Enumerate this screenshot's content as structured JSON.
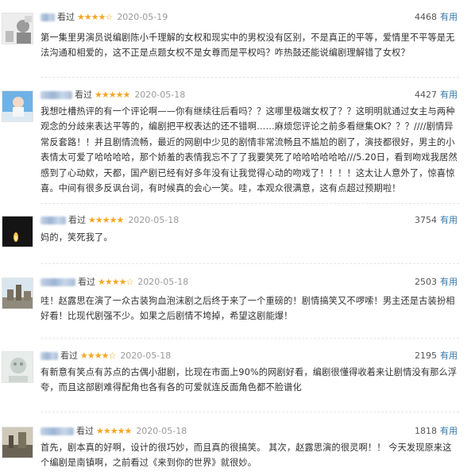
{
  "reviews": [
    {
      "status": "看过",
      "stars": "★★★★☆",
      "date": "2020-05-19",
      "votes": "4468",
      "useful_label": "有用",
      "text": "第一集里男演员说编剧陈小千理解的女权和现实中的男权没有区别，不是真正的平等，爱情里不平等是无法沟通和相爱的，这不正是点题女权不是女尊而是平权吗？咋热鼓还能说编剧理解错了女权？"
    },
    {
      "status": "看过",
      "stars": "★★★★★",
      "date": "2020-05-18",
      "votes": "4427",
      "useful_label": "有用",
      "text": "我想吐槽热评的有一个评论啊——你有继续往后看吗？？这哪里极端女权了？？这明明就通过女主与两种观念的分歧来表达平等的，编剧把平权表达的还不错啊……麻烦您评论之前多看继集OK？？？////剧情异常反套路！！并且剧情流畅，最近的网剧中少见的剧情非常流畅且不尴尬的剧了，演技都很好，男主的小表情太可爱了哈哈哈哈，那个娇羞的表情我忘不了了我要笑死了哈哈哈哈哈哈///5.20日，看到吻戏我居然感到了心动欸，天都，国产剧已经有好多年没有让我觉得心动的吻戏了！！！！这太让人意外了，惊喜惊喜。中间有很多反讽台词，有时候真的会心一笑。哇，本观众很满意，这有点超过预期啦！"
    },
    {
      "status": "看过",
      "stars": "★★★★★",
      "date": "2020-05-18",
      "votes": "3754",
      "useful_label": "有用",
      "text": "妈的，笑死我了。"
    },
    {
      "status": "看过",
      "stars": "★★★★☆",
      "date": "2020-05-18",
      "votes": "2503",
      "useful_label": "有用",
      "text": "哇！赵露思在演了一众古装狗血泡沫剧之后终于来了一个重磅的！剧情搞笑又不啰嗦！男主还是古装扮相好看！比现代剧强不少。如果之后剧情不垮掉，希望这剧能爆！"
    },
    {
      "status": "看过",
      "stars": "★★★★☆",
      "date": "2020-05-18",
      "votes": "2195",
      "useful_label": "有用",
      "text": "有新意有笑点有苏点的古偶小甜剧，比现在市面上90%的网剧好看，编剧很懂得收着来让剧情没有那么浮夸，而且这部剧难得配角也各有各的可爱就连反面角色都不脸谱化"
    },
    {
      "status": "看过",
      "stars": "★★★★★",
      "date": "2020-05-18",
      "votes": "1818",
      "useful_label": "有用",
      "text": "首先，剧本真的好啊，设计的很巧妙，而且真的很搞笑。 其次，赵露思演的很灵啊！！ 今天发现原来这个编剧是南镇啊，之前看过《来到你的世界》就很妙。"
    }
  ]
}
